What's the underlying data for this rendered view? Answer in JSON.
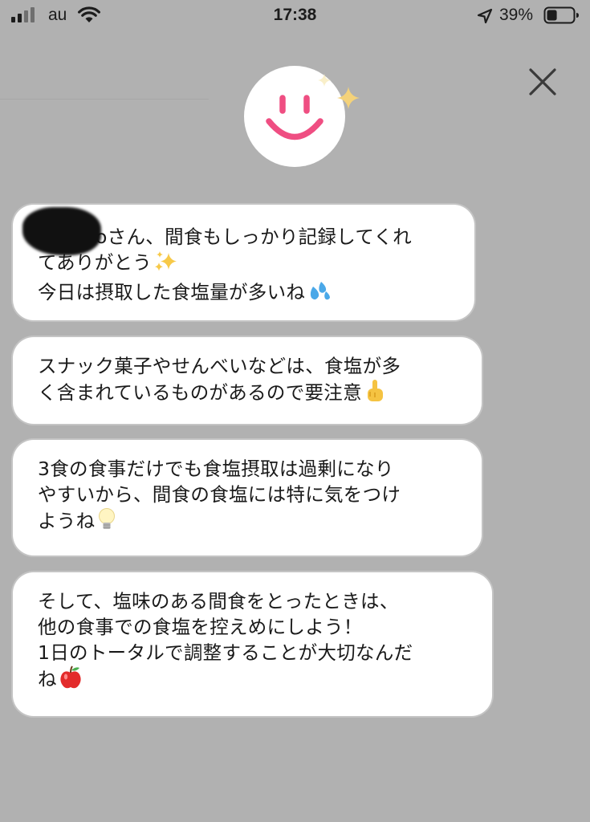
{
  "status_bar": {
    "carrier": "au",
    "time": "17:38",
    "battery_percent": "39%",
    "battery_level": 0.39,
    "signal_bars_active": 2,
    "signal_bars_total": 4,
    "icons": [
      "signal-icon",
      "wifi-icon",
      "location-icon",
      "battery-icon"
    ]
  },
  "header": {
    "close_icon": "close-icon",
    "avatar_icon": "smiley-face-icon",
    "avatar_accent": "#ef4e82",
    "sparkle_icon": "sparkles-icon"
  },
  "messages": [
    {
      "lines": [
        "oさん、間食もしっかり記録してくれ",
        "てありがとう",
        "今日は摂取した食塩量が多いね"
      ],
      "emojis": [
        "",
        "sparkles-emoji",
        "sweat-droplets-emoji"
      ]
    },
    {
      "lines": [
        "スナック菓子やせんべいなどは、食塩が多",
        "く含まれているものがあるので要注意"
      ],
      "emojis": [
        "",
        "pointing-up-emoji"
      ]
    },
    {
      "lines": [
        "3食の食事だけでも食塩摂取は過剰になり",
        "やすいから、間食の食塩には特に気をつけ",
        "ようね"
      ],
      "emojis": [
        "",
        "",
        "light-bulb-emoji"
      ]
    },
    {
      "lines": [
        "そして、塩味のある間食をとったときは、",
        "他の食事での食塩を控えめにしよう！",
        "1日のトータルで調整することが大切なんだ",
        "ね"
      ],
      "emojis": [
        "",
        "",
        "",
        "apple-emoji"
      ]
    }
  ]
}
